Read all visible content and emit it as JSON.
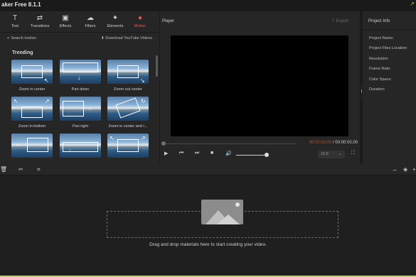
{
  "window": {
    "title": "aker Free 8.1.1"
  },
  "toolbar": {
    "items": [
      {
        "label": "Text",
        "icon": "text-icon"
      },
      {
        "label": "Transitions",
        "icon": "transitions-icon"
      },
      {
        "label": "Effects",
        "icon": "effects-icon"
      },
      {
        "label": "Filters",
        "icon": "filters-icon"
      },
      {
        "label": "Elements",
        "icon": "elements-icon"
      },
      {
        "label": "Motion",
        "icon": "motion-icon",
        "active": true
      }
    ],
    "active_color": "#e8564a"
  },
  "motion_panel": {
    "search_label": "Search motion",
    "youtube_label": "Download YouTube Videos",
    "section_title": "Trending",
    "items": [
      {
        "label": "Zoom in center"
      },
      {
        "label": "Pan down"
      },
      {
        "label": "Zoom out center"
      },
      {
        "label": "Zoom in bottom"
      },
      {
        "label": "Pan right"
      },
      {
        "label": "Zoom in center and r..."
      },
      {
        "label": ""
      },
      {
        "label": ""
      },
      {
        "label": ""
      }
    ]
  },
  "player": {
    "title": "Player",
    "export_label": "Export",
    "current_time": "00:00:00.00",
    "separator": " / ",
    "total_time": "00:00:00.00",
    "aspect_ratio": "16:9"
  },
  "project_info": {
    "title": "Project Info",
    "fields": [
      "Project Name:",
      "Project Files Location:",
      "Resolution:",
      "Frame Rate:",
      "Color Space:",
      "Duration:"
    ]
  },
  "timeline": {
    "drop_text": "Drag and drop materials here to start creating your video."
  }
}
